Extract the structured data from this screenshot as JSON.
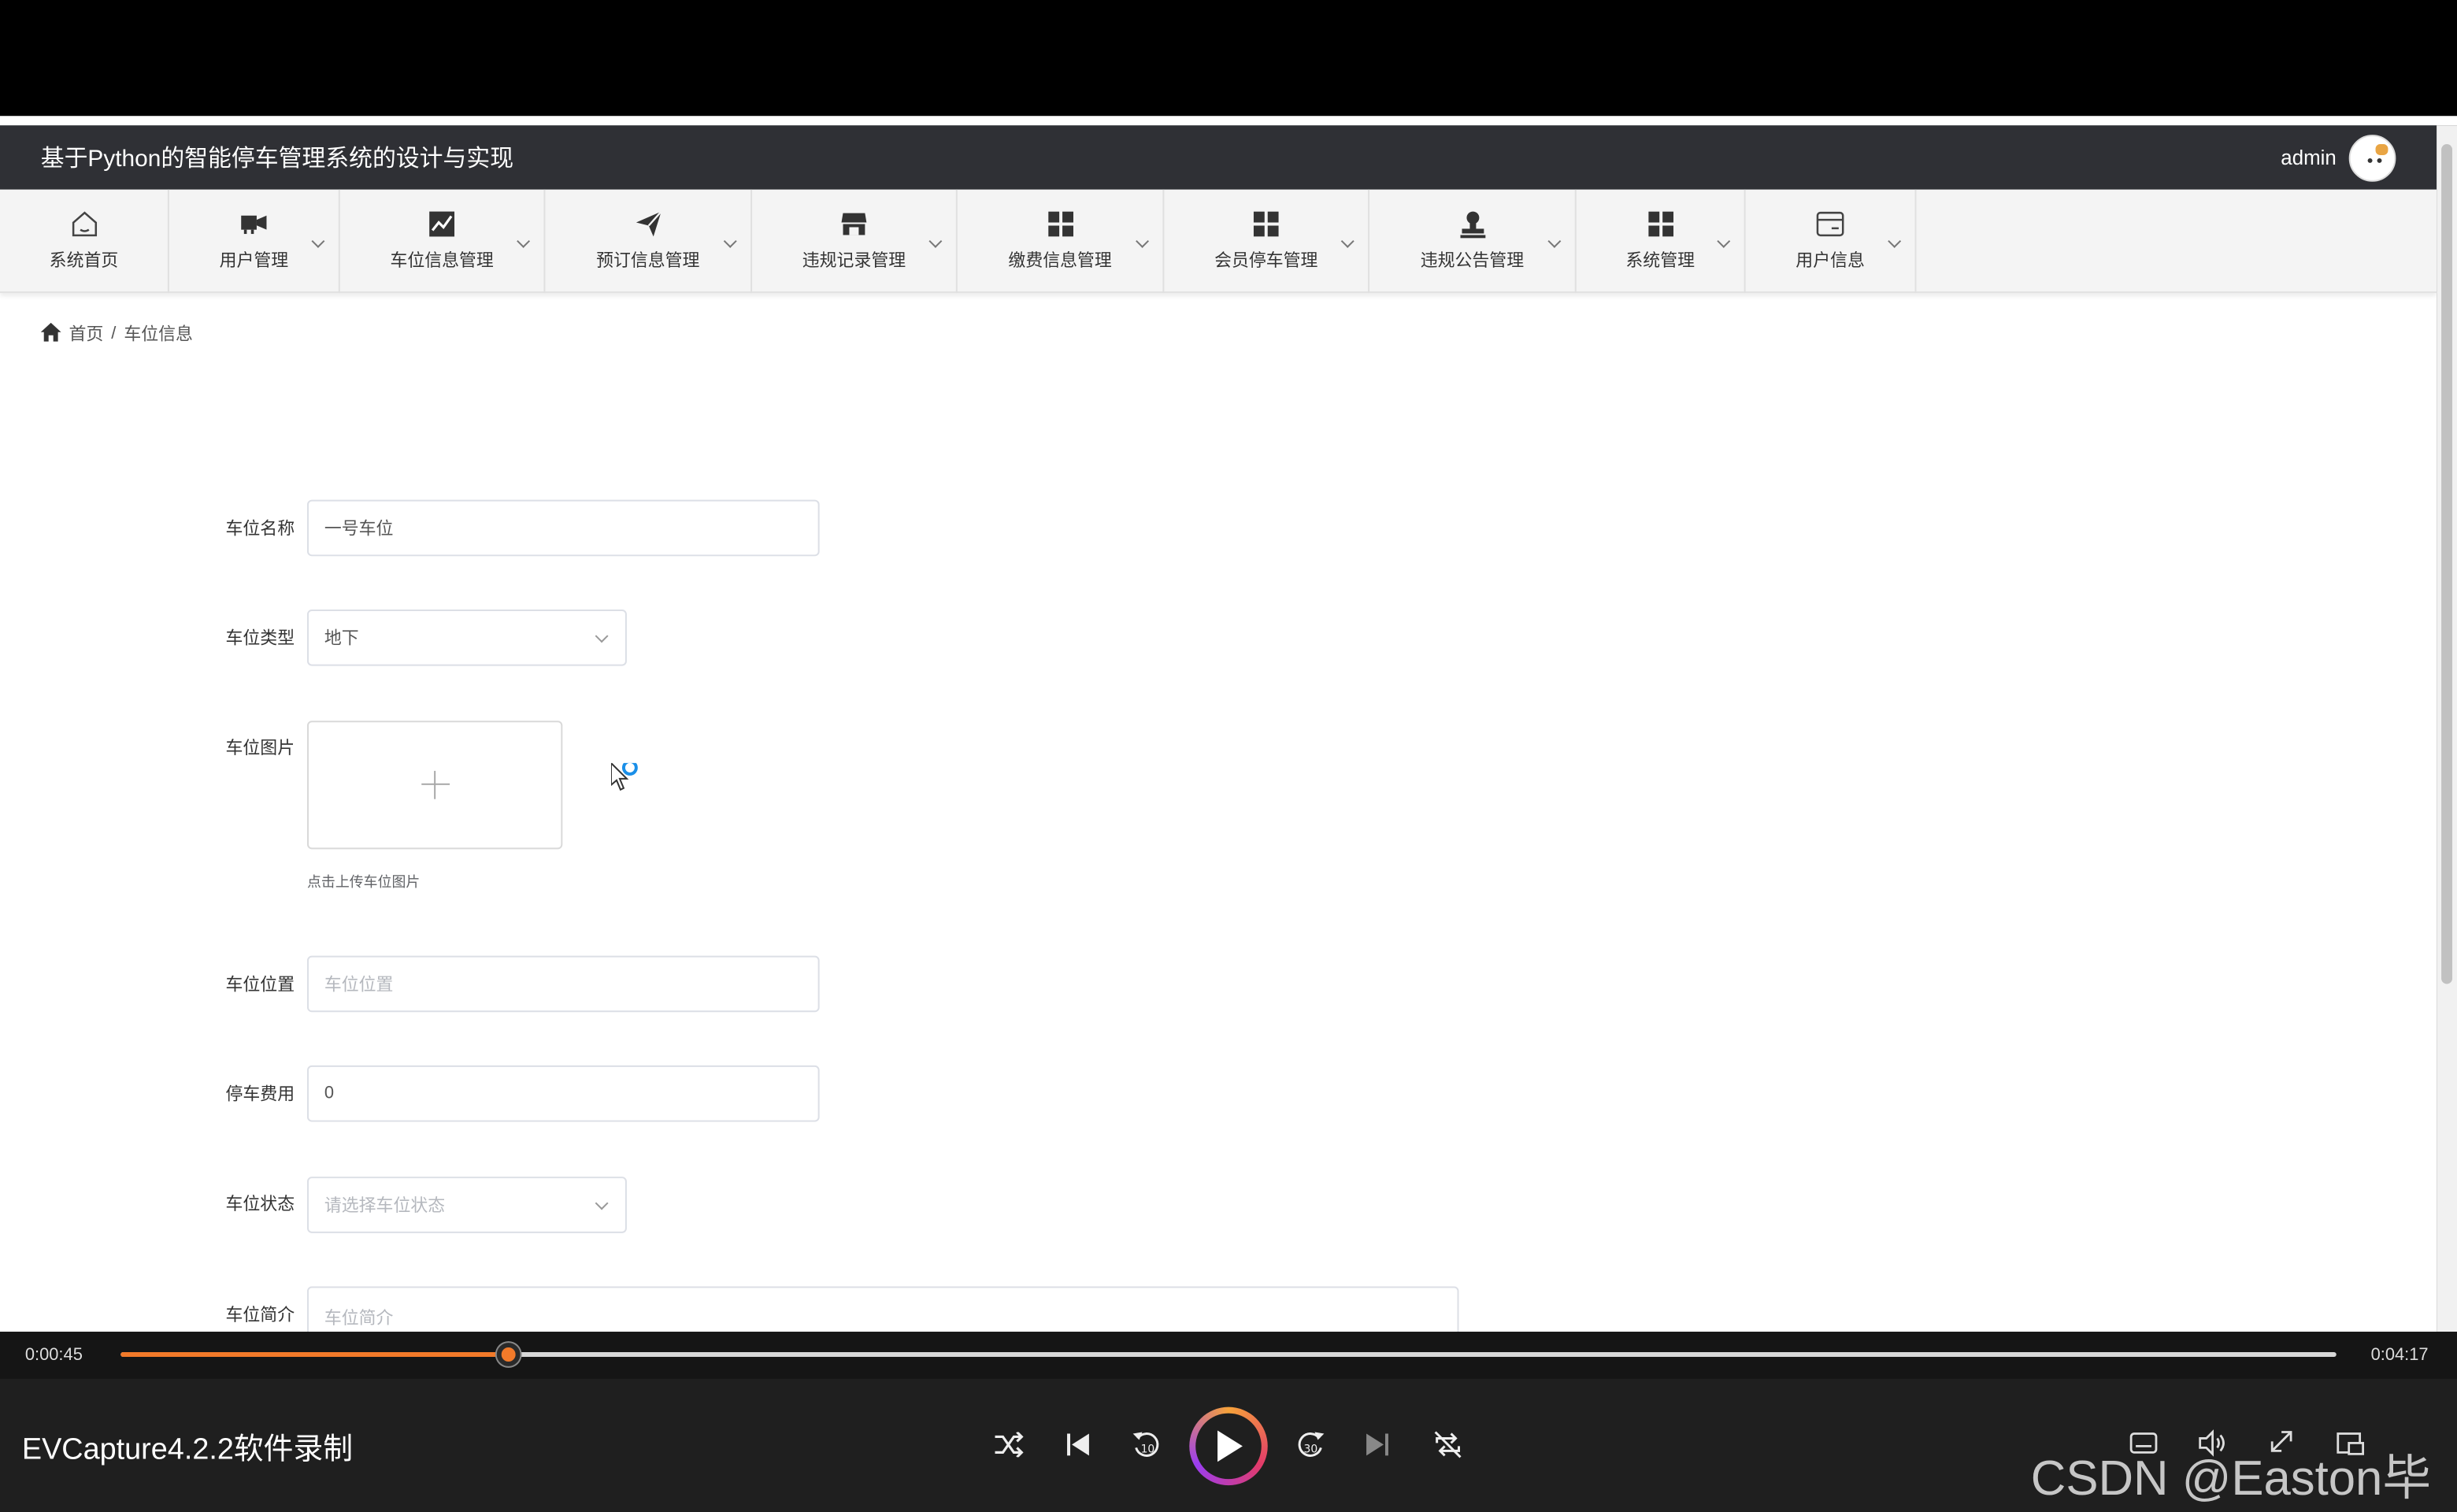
{
  "header": {
    "title": "基于Python的智能停车管理系统的设计与实现",
    "username": "admin"
  },
  "nav": [
    {
      "label": "系统首页",
      "icon": "home-icon"
    },
    {
      "label": "用户管理",
      "icon": "users-icon"
    },
    {
      "label": "车位信息管理",
      "icon": "chart-line-icon"
    },
    {
      "label": "预订信息管理",
      "icon": "send-icon"
    },
    {
      "label": "违规记录管理",
      "icon": "store-icon"
    },
    {
      "label": "缴费信息管理",
      "icon": "grid-icon"
    },
    {
      "label": "会员停车管理",
      "icon": "grid-icon"
    },
    {
      "label": "违规公告管理",
      "icon": "stamp-icon"
    },
    {
      "label": "系统管理",
      "icon": "grid-icon"
    },
    {
      "label": "用户信息",
      "icon": "card-icon"
    }
  ],
  "breadcrumb": {
    "home": "首页",
    "separator": "/",
    "current": "车位信息"
  },
  "form": {
    "name": {
      "label": "车位名称",
      "value": "一号车位"
    },
    "type": {
      "label": "车位类型",
      "value": "地下"
    },
    "image": {
      "label": "车位图片",
      "hint": "点击上传车位图片"
    },
    "location": {
      "label": "车位位置",
      "placeholder": "车位位置"
    },
    "fee": {
      "label": "停车费用",
      "value": "0"
    },
    "status": {
      "label": "车位状态",
      "placeholder": "请选择车位状态"
    },
    "intro": {
      "label": "车位简介",
      "placeholder": "车位简介"
    }
  },
  "player": {
    "current_time": "0:00:45",
    "total_time": "0:04:17",
    "progress": 0.1751,
    "recorder_label": "EVCapture4.2.2软件录制",
    "watermark": "CSDN @Easton毕设"
  },
  "colors": {
    "header_bg": "#2f3035",
    "accent": "#f27a2a"
  }
}
